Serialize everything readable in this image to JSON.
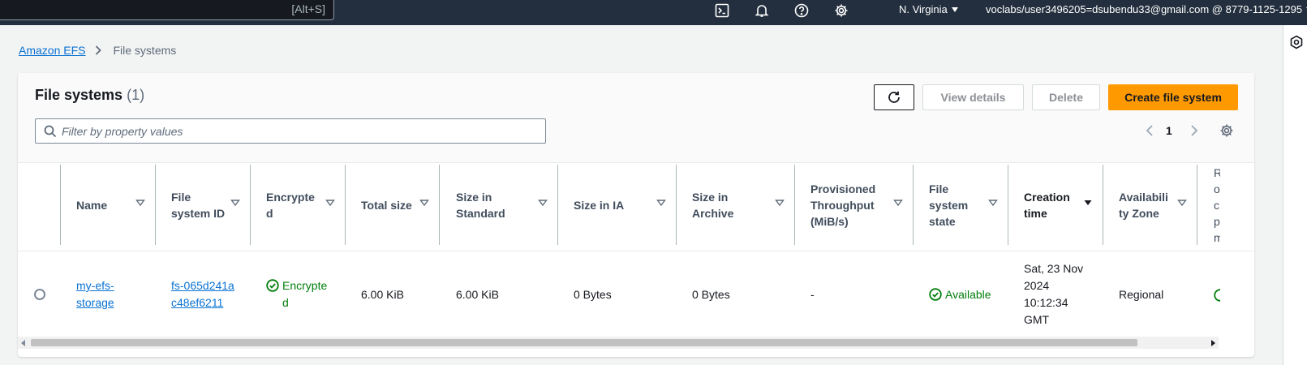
{
  "topnav": {
    "search_shortcut": "[Alt+S]",
    "icons": [
      "cloudshell-icon",
      "notifications-icon",
      "help-icon",
      "settings-icon"
    ],
    "region": "N. Virginia",
    "account": "voclabs/user3496205=dsubendu33@gmail.com @ 8779-1125-1295"
  },
  "breadcrumb": {
    "root": "Amazon EFS",
    "current": "File systems"
  },
  "panel": {
    "title": "File systems",
    "count": "(1)",
    "buttons": {
      "view_details": "View details",
      "delete": "Delete",
      "create": "Create file system"
    },
    "filter_placeholder": "Filter by property values",
    "page": "1"
  },
  "table": {
    "columns": [
      {
        "label": "Name",
        "sorted": false
      },
      {
        "label": "File system ID",
        "sorted": false
      },
      {
        "label": "Encrypted",
        "sorted": false
      },
      {
        "label": "Total size",
        "sorted": false
      },
      {
        "label": "Size in Standard",
        "sorted": false
      },
      {
        "label": "Size in IA",
        "sorted": false
      },
      {
        "label": "Size in Archive",
        "sorted": false
      },
      {
        "label": "Provisioned Throughput (MiB/s)",
        "sorted": false
      },
      {
        "label": "File system state",
        "sorted": false
      },
      {
        "label": "Creation time",
        "sorted": true
      },
      {
        "label": "Availability Zone",
        "sorted": false
      },
      {
        "label": "R o c p m",
        "sorted": false
      }
    ],
    "rows": [
      {
        "name": "my-efs-storage",
        "file_system_id": "fs-065d241ac48ef6211",
        "encrypted": "Encrypted",
        "total_size": "6.00 KiB",
        "size_standard": "6.00 KiB",
        "size_ia": "0 Bytes",
        "size_archive": "0 Bytes",
        "provisioned_throughput": "-",
        "state": "Available",
        "creation_time": "Sat, 23 Nov 2024 10:12:34 GMT",
        "availability_zone": "Regional"
      }
    ]
  },
  "colors": {
    "topbar": "#232f3e",
    "primary_button": "#ff9900",
    "link": "#0972d3",
    "success": "#037f0c"
  }
}
